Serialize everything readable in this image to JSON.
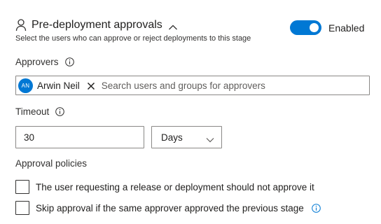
{
  "section": {
    "title": "Pre-deployment approvals",
    "subtitle": "Select the users who can approve or reject deployments to this stage",
    "toggle_label": "Enabled",
    "toggle_on": true,
    "accent_color": "#0078d4"
  },
  "approvers": {
    "label": "Approvers",
    "chips": [
      {
        "initials": "AN",
        "name": "Arwin Neil"
      }
    ],
    "search_placeholder": "Search users and groups for approvers"
  },
  "timeout": {
    "label": "Timeout",
    "value": "30",
    "unit": "Days"
  },
  "policies": {
    "label": "Approval policies",
    "options": [
      {
        "label": "The user requesting a release or deployment should not approve it",
        "checked": false
      },
      {
        "label": "Skip approval if the same approver approved the previous stage",
        "checked": false
      }
    ]
  },
  "icons": {
    "person": "person-icon",
    "chevron_up": "chevron-up-icon",
    "info": "info-icon",
    "remove": "close-icon",
    "chevron_down": "chevron-down-icon"
  }
}
